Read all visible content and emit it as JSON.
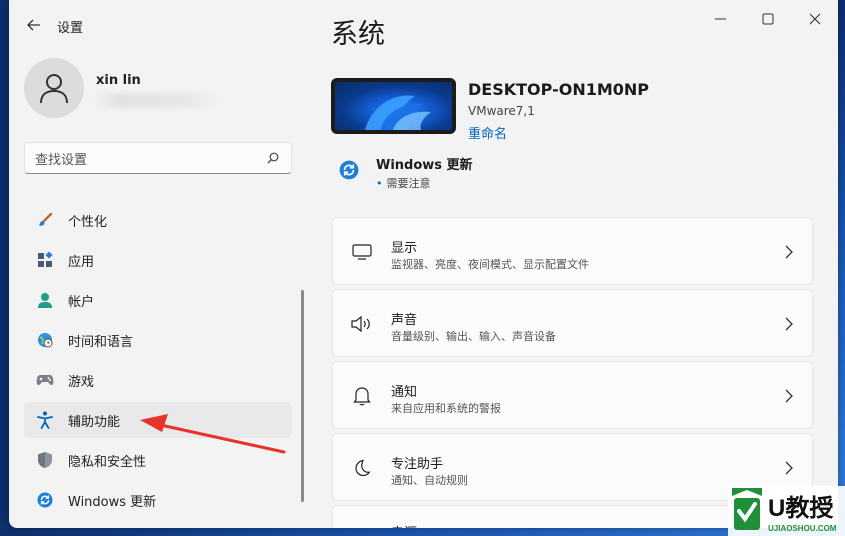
{
  "window": {
    "app_title": "设置",
    "back_label": "←"
  },
  "user": {
    "name": "xin lin"
  },
  "search": {
    "placeholder": "查找设置"
  },
  "sidebar": {
    "items": [
      {
        "label": "个性化",
        "icon": "paintbrush-icon"
      },
      {
        "label": "应用",
        "icon": "apps-icon"
      },
      {
        "label": "帐户",
        "icon": "person-icon"
      },
      {
        "label": "时间和语言",
        "icon": "globe-clock-icon"
      },
      {
        "label": "游戏",
        "icon": "gamepad-icon"
      },
      {
        "label": "辅助功能",
        "icon": "accessibility-icon",
        "selected": true
      },
      {
        "label": "隐私和安全性",
        "icon": "shield-icon"
      },
      {
        "label": "Windows 更新",
        "icon": "update-icon"
      }
    ]
  },
  "main": {
    "page_title": "系统",
    "device": {
      "name": "DESKTOP-ON1M0NP",
      "model": "VMware7,1",
      "rename_label": "重命名"
    },
    "update": {
      "title": "Windows 更新",
      "status": "需要注意"
    },
    "cards": [
      {
        "title": "显示",
        "desc": "监视器、亮度、夜间模式、显示配置文件",
        "icon": "monitor-icon"
      },
      {
        "title": "声音",
        "desc": "音量级别、输出、输入、声音设备",
        "icon": "speaker-icon"
      },
      {
        "title": "通知",
        "desc": "来自应用和系统的警报",
        "icon": "bell-icon"
      },
      {
        "title": "专注助手",
        "desc": "通知、自动规则",
        "icon": "moon-icon"
      }
    ],
    "partial_card_title": "电源"
  },
  "watermark": {
    "brand": "U教授",
    "domain": "UJIAOSHOU.COM"
  },
  "colors": {
    "accent": "#0067c0",
    "link": "#0063b8",
    "annotation": "#e8332a",
    "watermark_green": "#1f8f3a"
  }
}
